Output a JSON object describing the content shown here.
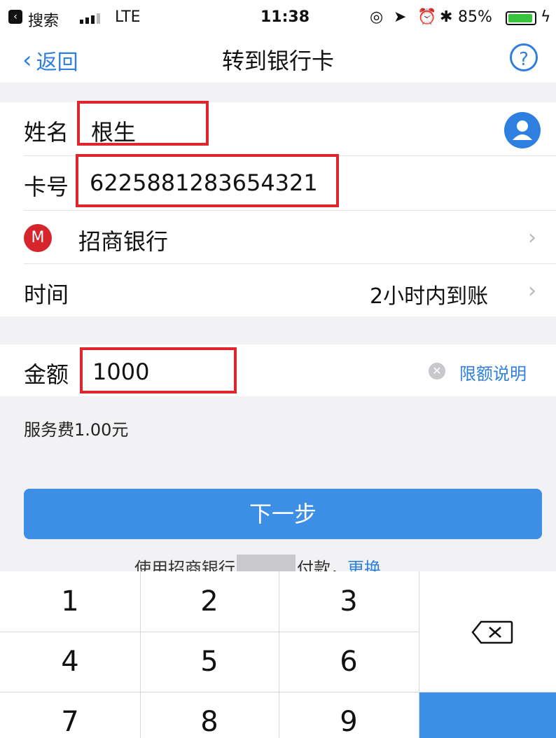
{
  "status_bar": {
    "back_app": "搜索",
    "carrier": "LTE",
    "time": "11:38",
    "battery": "85%"
  },
  "nav": {
    "back_label": "返回",
    "title": "转到银行卡",
    "help_symbol": "?"
  },
  "form": {
    "name_label": "姓名",
    "name_value": "根生",
    "card_label": "卡号",
    "card_value": "6225881283654321",
    "bank_name": "招商银行",
    "time_label": "时间",
    "time_value": "2小时内到账",
    "amount_label": "金额",
    "amount_value": "1000",
    "limit_link": "限额说明",
    "fee_text": "服务费1.00元"
  },
  "actions": {
    "next_label": "下一步",
    "pay_prefix": "使用招商银行",
    "pay_suffix": "付款，",
    "change_link": "更换"
  },
  "keypad": {
    "keys": [
      "1",
      "2",
      "3",
      "4",
      "5",
      "6",
      "7",
      "8",
      "9"
    ]
  },
  "colors": {
    "accent": "#2f7fe0",
    "button": "#3d8fe6",
    "highlight": "#e0262c",
    "bank_logo": "#d6262c"
  }
}
